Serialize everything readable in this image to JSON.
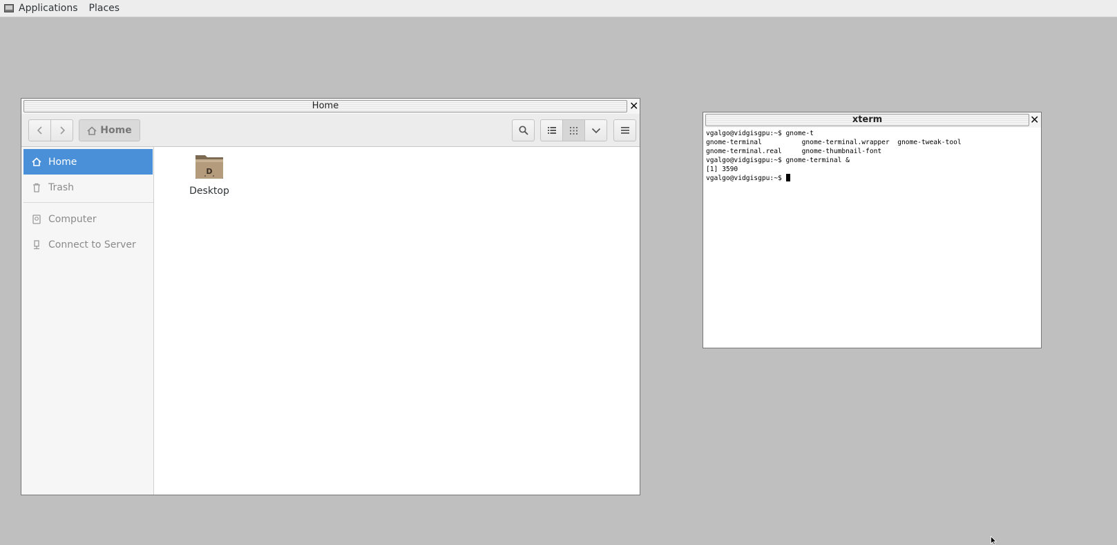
{
  "top_panel": {
    "applications_label": "Applications",
    "places_label": "Places"
  },
  "files_window": {
    "title": "Home",
    "toolbar": {
      "path_home_label": "Home",
      "back_icon": "chevron-left-icon",
      "forward_icon": "chevron-right-icon",
      "search_icon": "search-icon",
      "list_view_icon": "list-view-icon",
      "grid_view_icon": "grid-view-icon",
      "view_options_icon": "chevron-down-icon",
      "menu_icon": "hamburger-menu-icon"
    },
    "sidebar": {
      "items": [
        {
          "label": "Home",
          "icon": "home-icon",
          "selected": true
        },
        {
          "label": "Trash",
          "icon": "trash-icon"
        },
        {
          "label": "Computer",
          "icon": "computer-icon"
        },
        {
          "label": "Connect to Server",
          "icon": "server-icon"
        }
      ]
    },
    "content": {
      "items": [
        {
          "label": "Desktop",
          "icon": "folder-desktop-icon"
        }
      ]
    },
    "accent_color": "#4a90d9"
  },
  "xterm_window": {
    "title": "xterm",
    "lines": [
      "vgalgo@vidgisgpu:~$ gnome-t",
      "gnome-terminal          gnome-terminal.wrapper  gnome-tweak-tool",
      "gnome-terminal.real     gnome-thumbnail-font",
      "vgalgo@vidgisgpu:~$ gnome-terminal &",
      "[1] 3590"
    ],
    "prompt": "vgalgo@vidgisgpu:~$ "
  }
}
